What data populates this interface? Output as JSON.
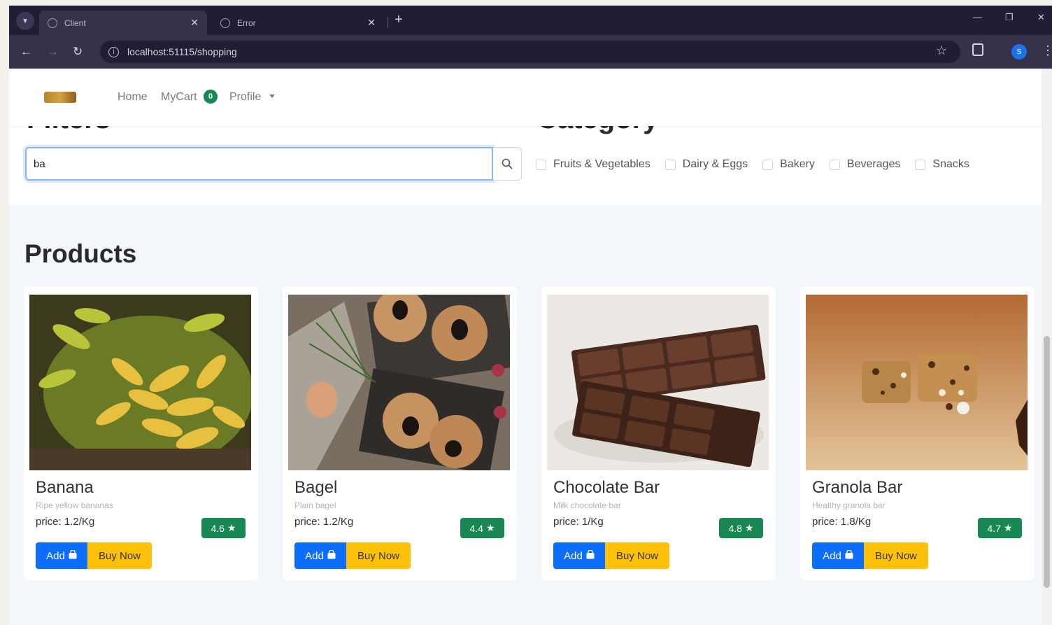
{
  "browser": {
    "tabs": [
      {
        "title": "Client",
        "active": true
      },
      {
        "title": "Error",
        "active": false
      }
    ],
    "url": "localhost:51115/shopping",
    "profile_initial": "S"
  },
  "navbar": {
    "home": "Home",
    "mycart": "MyCart",
    "cart_count": "0",
    "profile": "Profile"
  },
  "filters": {
    "title": "Filters",
    "search_value": "ba",
    "category_title": "Category",
    "categories": [
      "Fruits & Vegetables",
      "Dairy & Eggs",
      "Bakery",
      "Beverages",
      "Snacks"
    ]
  },
  "products": {
    "title": "Products",
    "items": [
      {
        "name": "Banana",
        "description": "Ripe yellow bananas",
        "price": "price: 1.2/Kg",
        "rating": "4.6",
        "add_label": "Add",
        "buy_label": "Buy Now"
      },
      {
        "name": "Bagel",
        "description": "Plain bagel",
        "price": "price: 1.2/Kg",
        "rating": "4.4",
        "add_label": "Add",
        "buy_label": "Buy Now"
      },
      {
        "name": "Chocolate Bar",
        "description": "Milk chocolate bar",
        "price": "price: 1/Kg",
        "rating": "4.8",
        "add_label": "Add",
        "buy_label": "Buy Now"
      },
      {
        "name": "Granola Bar",
        "description": "Healthy granola bar",
        "price": "price: 1.8/Kg",
        "rating": "4.7",
        "add_label": "Add",
        "buy_label": "Buy Now"
      }
    ]
  },
  "colors": {
    "primary": "#0d6efd",
    "warning": "#ffc107",
    "success": "#198754",
    "chrome_dark": "#211d34",
    "chrome_toolbar": "#36324c"
  },
  "icons": [
    "chevron-down-icon",
    "globe-icon",
    "close-icon",
    "plus-icon",
    "back-icon",
    "forward-icon",
    "reload-icon",
    "info-icon",
    "star-icon",
    "extensions-icon",
    "kebab-icon",
    "search-icon",
    "bag-icon",
    "rating-star-icon"
  ]
}
